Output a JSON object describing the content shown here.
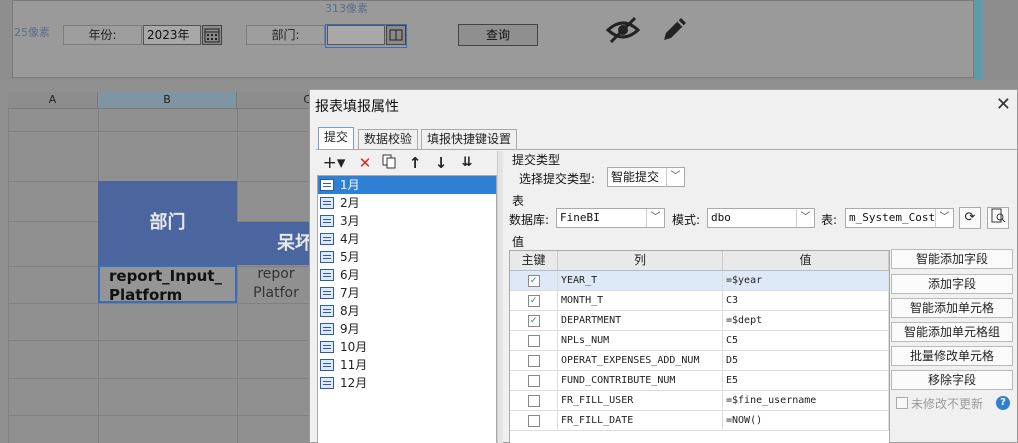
{
  "param_panel": {
    "top_width_label": "313像素",
    "left_height_label": "25像素",
    "year_label": "年份:",
    "year_value": "2023年",
    "dept_label": "部门:",
    "query_button": "查询"
  },
  "sheet": {
    "columns": [
      "A",
      "B",
      "C"
    ],
    "header_dept": "部门",
    "header_dept_cont": "呆坏",
    "cell_selected_line1": "report_Input_",
    "cell_selected_line2": "Platform",
    "cell_next_line1": "repor",
    "cell_next_line2": "Platfor"
  },
  "dialog": {
    "title": "报表填报属性",
    "tabs": [
      "提交",
      "数据校验",
      "填报快捷键设置"
    ],
    "months": [
      "1月",
      "2月",
      "3月",
      "4月",
      "5月",
      "6月",
      "7月",
      "8月",
      "9月",
      "10月",
      "11月",
      "12月"
    ],
    "submit_type_section": "提交类型",
    "submit_type_label": "选择提交类型:",
    "submit_type_value": "智能提交",
    "table_section": "表",
    "db_label": "数据库:",
    "db_value": "FineBI",
    "schema_label": "模式:",
    "schema_value": "dbo",
    "table_label": "表:",
    "table_value": "m_System_Cost",
    "value_section": "值",
    "columns_header": {
      "pk": "主键",
      "col": "列",
      "val": "值"
    },
    "rows": [
      {
        "pk": true,
        "col": "YEAR_T",
        "val": "=$year"
      },
      {
        "pk": true,
        "col": "MONTH_T",
        "val": "C3"
      },
      {
        "pk": true,
        "col": "DEPARTMENT",
        "val": "=$dept"
      },
      {
        "pk": false,
        "col": "NPLs_NUM",
        "val": "C5"
      },
      {
        "pk": false,
        "col": "OPERAT_EXPENSES_ADD_NUM",
        "val": "D5"
      },
      {
        "pk": false,
        "col": "FUND_CONTRIBUTE_NUM",
        "val": "E5"
      },
      {
        "pk": false,
        "col": "FR_FILL_USER",
        "val": "=$fine_username"
      },
      {
        "pk": false,
        "col": "FR_FILL_DATE",
        "val": "=NOW()"
      }
    ],
    "side_buttons": [
      "智能添加字段",
      "添加字段",
      "智能添加单元格",
      "智能添加单元格组",
      "批量修改单元格",
      "移除字段"
    ],
    "no_update_label": "未修改不更新"
  }
}
